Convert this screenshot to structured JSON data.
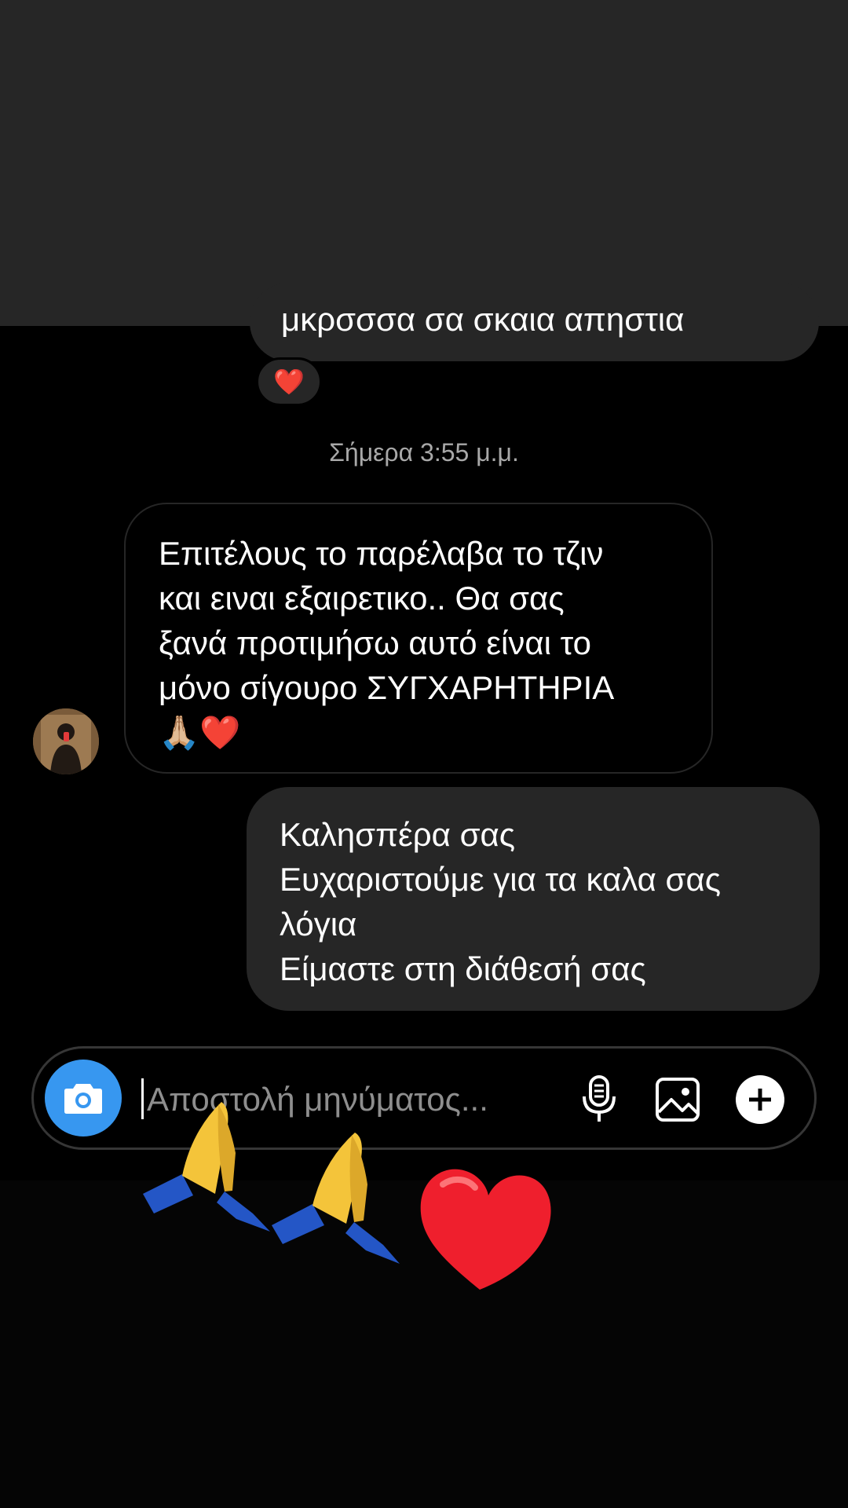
{
  "thread": {
    "cut_off_message": "μκρσσσα σα σκαια απηστια",
    "reaction": "❤️",
    "timestamp": "Σήμερα 3:55 μ.μ.",
    "incoming_message": "Επιτέλους το παρέλαβα το τζιν\nκαι ειναι εξαιρετικο.. Θα σας\nξανά προτιμήσω αυτό είναι το\nμόνο σίγουρο ΣΥΓΧΑΡΗΤΗΡΙΑ",
    "incoming_emoji": "🙏🏼❤️",
    "outgoing_message": "Καλησπέρα σας\nΕυχαριστούμε για τα καλα σας\nλόγια\nΕίμαστε στη διάθεσή σας"
  },
  "composer": {
    "placeholder": "Αποστολή μηνύματος..."
  },
  "colors": {
    "background": "#000000",
    "bubble": "#262626",
    "accent_blue": "#3797f0",
    "heart_red": "#ff2d3c"
  },
  "icons": {
    "camera": "camera-icon",
    "mic": "microphone-icon",
    "gallery": "image-icon",
    "plus": "plus-icon",
    "stickers": [
      "praying-hands-sticker",
      "praying-hands-sticker",
      "heart-sticker"
    ]
  }
}
